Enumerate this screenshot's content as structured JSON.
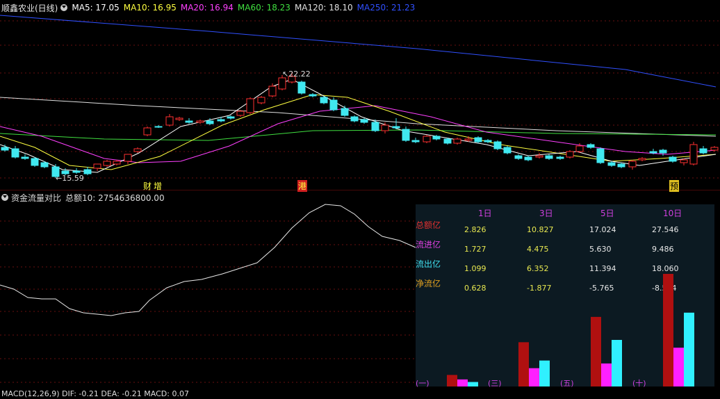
{
  "main": {
    "title": "顺鑫农业(日线)",
    "ma": [
      {
        "label": "MA5: 17.05",
        "color": "#ffffff"
      },
      {
        "label": "MA10: 16.95",
        "color": "#ffff40"
      },
      {
        "label": "MA20: 16.94",
        "color": "#ff40ff"
      },
      {
        "label": "MA60: 18.23",
        "color": "#40e040"
      },
      {
        "label": "MA120: 18.10",
        "color": "#e0e0e0"
      },
      {
        "label": "MA250: 21.23",
        "color": "#3050ff"
      }
    ],
    "high_label": "22.22",
    "low_label": "15.59",
    "event_markers": [
      "财",
      "增",
      "港",
      "预"
    ]
  },
  "sub": {
    "title": "资金流量对比",
    "total_label": "总额10: 2754636800.00"
  },
  "panel": {
    "columns": [
      "1日",
      "3日",
      "5日",
      "10日"
    ],
    "rows": [
      {
        "label": "总额亿",
        "color": "#e03030",
        "values": [
          "2.826",
          "10.827",
          "17.024",
          "27.546"
        ]
      },
      {
        "label": "流进亿",
        "color": "#e040e0",
        "values": [
          "1.727",
          "4.475",
          "5.630",
          "9.486"
        ]
      },
      {
        "label": "流出亿",
        "color": "#40e0f0",
        "values": [
          "1.099",
          "6.352",
          "11.394",
          "18.060"
        ]
      },
      {
        "label": "净流亿",
        "color": "#e0a020",
        "values": [
          "0.628",
          "-1.877",
          "-5.765",
          "-8.574"
        ]
      }
    ],
    "group_labels": [
      "(一)",
      "(三)",
      "(五)",
      "(十)"
    ]
  },
  "bottom": {
    "text": "MACD(12,26,9) DIF: -0.21 DEA: -0.21 MACD: 0.07"
  }
}
